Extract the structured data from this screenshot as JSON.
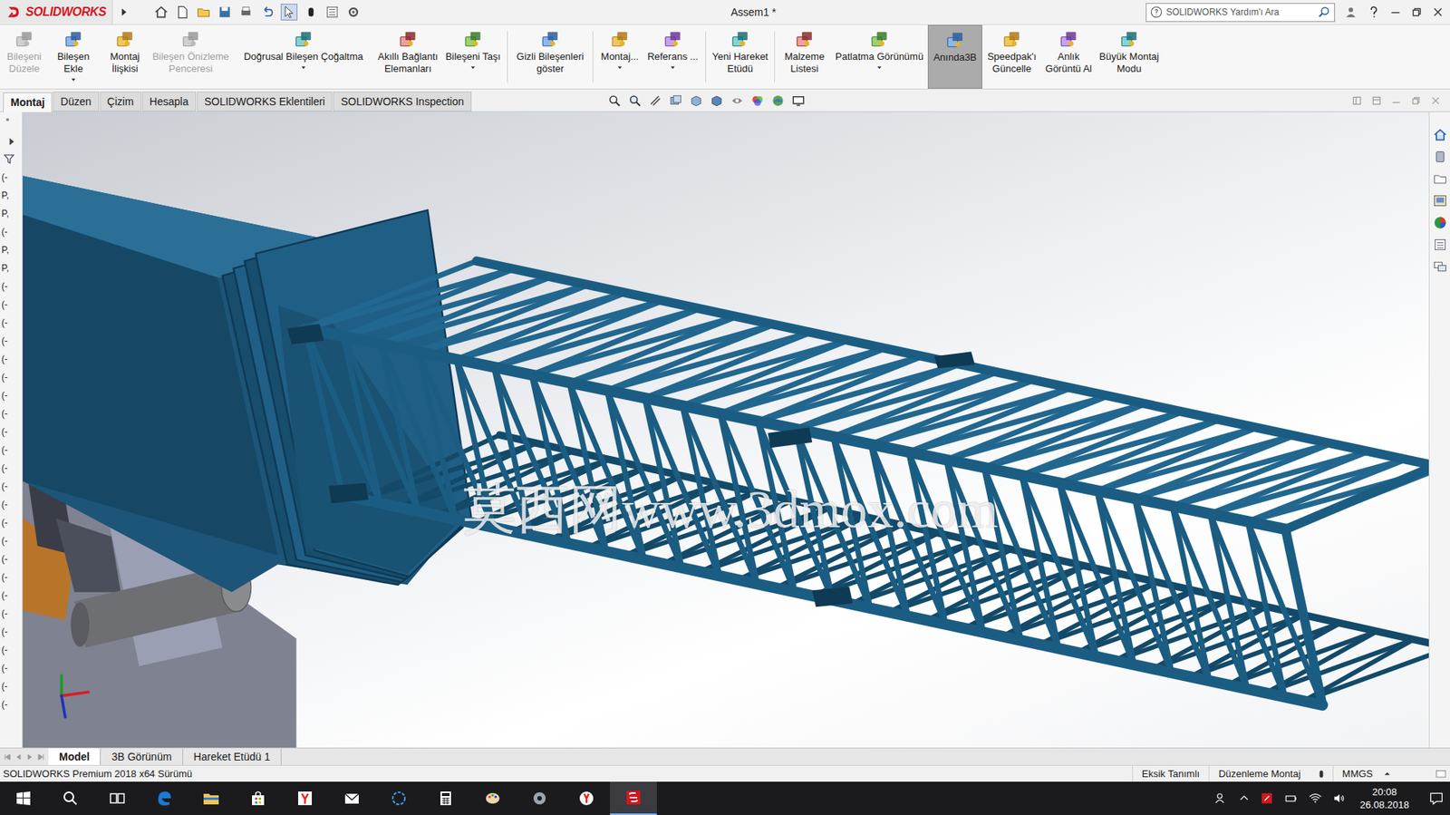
{
  "app": {
    "logo": "SOLIDWORKS",
    "title": "Assem1 *",
    "search_placeholder": "SOLIDWORKS Yardım'ı Ara"
  },
  "ribbon": [
    {
      "label": "Bileşeni Düzele",
      "disabled": true,
      "dropdown": false,
      "selected": false
    },
    {
      "label": "Bileşen Ekle",
      "disabled": false,
      "dropdown": true,
      "selected": false
    },
    {
      "label": "Montaj İlişkisi",
      "disabled": false,
      "dropdown": false,
      "selected": false
    },
    {
      "label": "Bileşen Önizleme Penceresi",
      "disabled": true,
      "dropdown": false,
      "selected": false
    },
    {
      "label": "Doğrusal Bileşen Çoğaltma",
      "disabled": false,
      "dropdown": true,
      "selected": false
    },
    {
      "label": "Akıllı Bağlantı Elemanları",
      "disabled": false,
      "dropdown": false,
      "selected": false
    },
    {
      "label": "Bileşeni Taşı",
      "disabled": false,
      "dropdown": true,
      "selected": false
    },
    {
      "label": "Gizli Bileşenleri göster",
      "disabled": false,
      "dropdown": false,
      "selected": false
    },
    {
      "label": "Montaj...",
      "disabled": false,
      "dropdown": true,
      "selected": false
    },
    {
      "label": "Referans ...",
      "disabled": false,
      "dropdown": true,
      "selected": false
    },
    {
      "label": "Yeni Hareket Etüdü",
      "disabled": false,
      "dropdown": false,
      "selected": false
    },
    {
      "label": "Malzeme Listesi",
      "disabled": false,
      "dropdown": false,
      "selected": false
    },
    {
      "label": "Patlatma Görünümü",
      "disabled": false,
      "dropdown": true,
      "selected": false
    },
    {
      "label": "Anında3B",
      "disabled": false,
      "dropdown": false,
      "selected": true
    },
    {
      "label": "Speedpak'ı Güncelle",
      "disabled": false,
      "dropdown": false,
      "selected": false
    },
    {
      "label": "Anlık Görüntü Al",
      "disabled": false,
      "dropdown": false,
      "selected": false
    },
    {
      "label": "Büyük Montaj Modu",
      "disabled": false,
      "dropdown": false,
      "selected": false
    }
  ],
  "tabs": [
    {
      "label": "Montaj",
      "selected": true
    },
    {
      "label": "Düzen",
      "selected": false
    },
    {
      "label": "Çizim",
      "selected": false
    },
    {
      "label": "Hesapla",
      "selected": false
    },
    {
      "label": "SOLIDWORKS Eklentileri",
      "selected": false
    },
    {
      "label": "SOLIDWORKS Inspection",
      "selected": false
    }
  ],
  "tree_marks": [
    "(-",
    "P,",
    "P,",
    "(-",
    "P,",
    "P,",
    "(-",
    "(-",
    "(-",
    "(-",
    "(-",
    "(-",
    "(-",
    "(-",
    "(-",
    "(-",
    "(-",
    "(-",
    "(-",
    "(-",
    "(-",
    "(-",
    "(-",
    "(-",
    "(-",
    "(-",
    "(-",
    "(-",
    "(-",
    "(-"
  ],
  "watermark": "莫西网www.3dmox.com",
  "bottom_tabs": [
    {
      "label": "Model",
      "selected": true
    },
    {
      "label": "3B Görünüm",
      "selected": false
    },
    {
      "label": "Hareket Etüdü 1",
      "selected": false
    }
  ],
  "status": {
    "version": "SOLIDWORKS Premium 2018 x64 Sürümü",
    "items": [
      "Eksik Tanımlı",
      "Düzenleme Montaj",
      "MMGS"
    ]
  },
  "taskbar": {
    "time": "20:08",
    "date": "26.08.2018"
  }
}
